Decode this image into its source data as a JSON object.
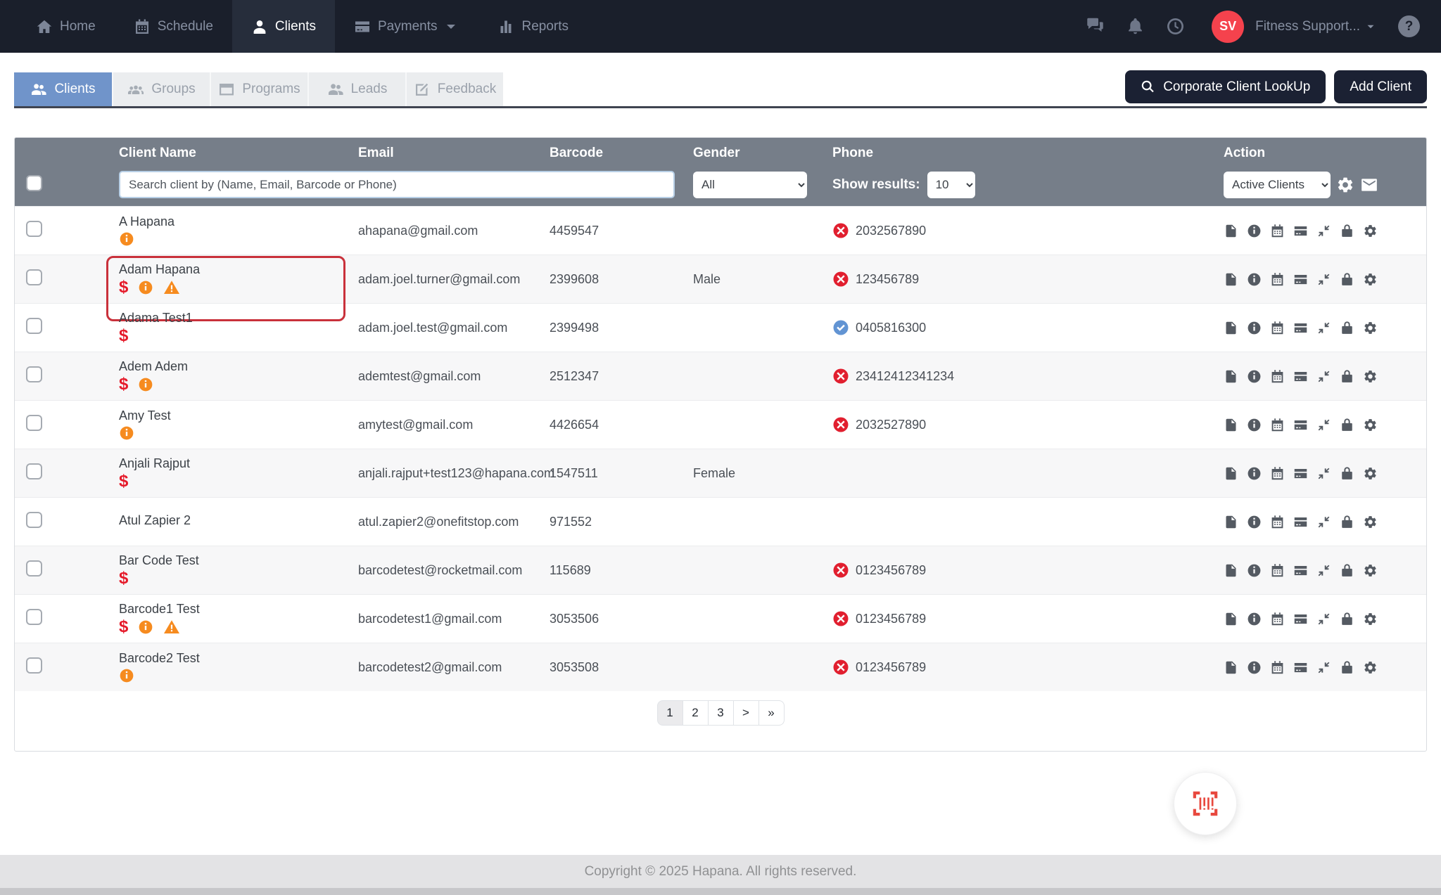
{
  "colors": {
    "navbar_bg": "#1a1f2b",
    "accent_red": "#e51b2b",
    "avatar_red": "#f5424d",
    "warning_orange": "#f68b1f",
    "phone_invalid_red": "#e11f2f",
    "phone_valid_blue": "#6294d3",
    "tab_active_blue": "#7094ca",
    "table_header_gray": "#767e89",
    "button_dark": "#1b2133"
  },
  "navbar": {
    "items": [
      {
        "label": "Home",
        "icon": "home-icon",
        "active": false
      },
      {
        "label": "Schedule",
        "icon": "calendar-icon",
        "active": false
      },
      {
        "label": "Clients",
        "icon": "user-icon",
        "active": true
      },
      {
        "label": "Payments",
        "icon": "credit-card-icon",
        "active": false
      },
      {
        "label": "Reports",
        "icon": "bar-chart-icon",
        "active": false
      }
    ],
    "right_icons": [
      "chat-icon",
      "bell-icon",
      "clock-icon",
      "help-icon"
    ],
    "account": {
      "initials": "SV",
      "name": "Fitness Support..."
    }
  },
  "tabs": [
    {
      "label": "Clients",
      "icon": "people-icon",
      "active": true
    },
    {
      "label": "Groups",
      "icon": "group-icon",
      "active": false
    },
    {
      "label": "Programs",
      "icon": "window-icon",
      "active": false
    },
    {
      "label": "Leads",
      "icon": "leads-icon",
      "active": false
    },
    {
      "label": "Feedback",
      "icon": "edit-icon",
      "active": false
    }
  ],
  "toolbar": {
    "corporate_lookup": "Corporate Client LookUp",
    "add_client": "Add Client"
  },
  "table": {
    "columns": [
      "Client Name",
      "Email",
      "Barcode",
      "Gender",
      "Phone",
      "Action"
    ],
    "filters": {
      "search_placeholder": "Search client by (Name, Email, Barcode or Phone)",
      "gender_value": "All",
      "show_results_label": "Show results:",
      "show_results_value": "10",
      "status_value": "Active Clients",
      "tool_icons": [
        "gear-icon",
        "envelope-icon"
      ]
    },
    "action_icons": [
      {
        "name": "notes",
        "icon": "file"
      },
      {
        "name": "info",
        "icon": "info"
      },
      {
        "name": "schedule",
        "icon": "calendar"
      },
      {
        "name": "payment",
        "icon": "card"
      },
      {
        "name": "check-in",
        "icon": "compress"
      },
      {
        "name": "lock",
        "icon": "lock"
      },
      {
        "name": "settings",
        "icon": "gear"
      }
    ],
    "rows": [
      {
        "name": "A Hapana",
        "badges": [
          "info"
        ],
        "email": "ahapana@gmail.com",
        "barcode": "4459547",
        "gender": "",
        "phone": "2032567890",
        "phone_status": "invalid",
        "highlighted": false
      },
      {
        "name": "Adam Hapana",
        "badges": [
          "outstanding-payment",
          "info",
          "warning"
        ],
        "email": "adam.joel.turner@gmail.com",
        "barcode": "2399608",
        "gender": "Male",
        "phone": "123456789",
        "phone_status": "invalid",
        "highlighted": true
      },
      {
        "name": "Adama Test1",
        "badges": [
          "outstanding-payment"
        ],
        "email": "adam.joel.test@gmail.com",
        "barcode": "2399498",
        "gender": "",
        "phone": "0405816300",
        "phone_status": "valid",
        "highlighted": false
      },
      {
        "name": "Adem Adem",
        "badges": [
          "outstanding-payment",
          "info"
        ],
        "email": "ademtest@gmail.com",
        "barcode": "2512347",
        "gender": "",
        "phone": "23412412341234",
        "phone_status": "invalid",
        "highlighted": false
      },
      {
        "name": "Amy Test",
        "badges": [
          "info"
        ],
        "email": "amytest@gmail.com",
        "barcode": "4426654",
        "gender": "",
        "phone": "2032527890",
        "phone_status": "invalid",
        "highlighted": false
      },
      {
        "name": "Anjali Rajput",
        "badges": [
          "outstanding-payment"
        ],
        "email": "anjali.rajput+test123@hapana.com",
        "barcode": "1547511",
        "gender": "Female",
        "phone": "",
        "phone_status": "none",
        "highlighted": false
      },
      {
        "name": "Atul Zapier 2",
        "badges": [],
        "email": "atul.zapier2@onefitstop.com",
        "barcode": "971552",
        "gender": "",
        "phone": "",
        "phone_status": "none",
        "highlighted": false
      },
      {
        "name": "Bar Code Test",
        "badges": [
          "outstanding-payment"
        ],
        "email": "barcodetest@rocketmail.com",
        "barcode": "115689",
        "gender": "",
        "phone": "0123456789",
        "phone_status": "invalid",
        "highlighted": false
      },
      {
        "name": "Barcode1 Test",
        "badges": [
          "outstanding-payment",
          "info",
          "warning"
        ],
        "email": "barcodetest1@gmail.com",
        "barcode": "3053506",
        "gender": "",
        "phone": "0123456789",
        "phone_status": "invalid",
        "highlighted": false
      },
      {
        "name": "Barcode2 Test",
        "badges": [
          "info"
        ],
        "email": "barcodetest2@gmail.com",
        "barcode": "3053508",
        "gender": "",
        "phone": "0123456789",
        "phone_status": "invalid",
        "highlighted": false
      }
    ]
  },
  "pagination": {
    "pages": [
      "1",
      "2",
      "3",
      ">",
      "»"
    ],
    "active": "1"
  },
  "fab": {
    "icon": "barcode-scan-icon"
  },
  "footer": {
    "copyright": "Copyright © 2025 Hapana. All rights reserved."
  }
}
